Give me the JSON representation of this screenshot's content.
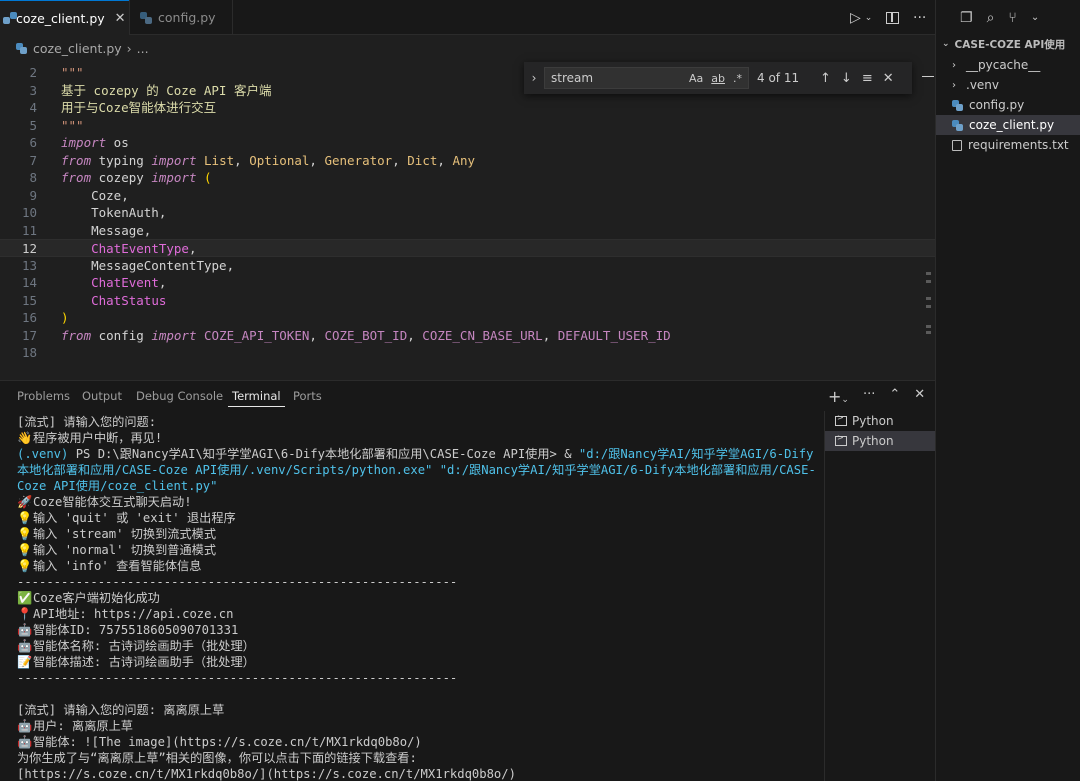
{
  "tabs": [
    {
      "label": "coze_client.py",
      "active": true
    },
    {
      "label": "config.py",
      "active": false
    }
  ],
  "breadcrumb": {
    "file": "coze_client.py",
    "sep": "›",
    "more": "..."
  },
  "find": {
    "value": "stream",
    "case_opt": "Aa",
    "word_opt": "ab",
    "regex_opt": ".*",
    "count": "4 of 11"
  },
  "code_lines": [
    {
      "n": "2",
      "html": "<span class=\"str\">\"\"\"</span>"
    },
    {
      "n": "3",
      "html": "<span class=\"cn\">基于</span><span class=\"tx\"> </span><span class=\"cn\">cozepy 的 Coze API 客户端</span>"
    },
    {
      "n": "4",
      "html": "<span class=\"cn\">用于与Coze智能体进行交互</span>"
    },
    {
      "n": "5",
      "html": "<span class=\"str\">\"\"\"</span>"
    },
    {
      "n": "6",
      "html": "<span class=\"kw\">import</span><span class=\"tx\"> os</span>"
    },
    {
      "n": "7",
      "html": "<span class=\"kw\">from</span><span class=\"tx\"> typing </span><span class=\"kw\">import</span><span class=\"tx\"> </span><span class=\"ty\">List</span><span class=\"tx\">, </span><span class=\"ty\">Optional</span><span class=\"tx\">, </span><span class=\"ty\">Generator</span><span class=\"tx\">, </span><span class=\"ty\">Dict</span><span class=\"tx\">, </span><span class=\"ty\">Any</span>"
    },
    {
      "n": "8",
      "html": "<span class=\"kw\">from</span><span class=\"tx\"> cozepy </span><span class=\"kw\">import</span><span class=\"tx\"> </span><span class=\"brk\">(</span>"
    },
    {
      "n": "9",
      "html": "<span class=\"tx\">    Coze,</span>"
    },
    {
      "n": "10",
      "html": "<span class=\"tx\">    TokenAuth,</span>"
    },
    {
      "n": "11",
      "html": "<span class=\"tx\">    Message,</span>"
    },
    {
      "n": "12",
      "html": "<span class=\"tx\">    </span><span class=\"pink\">ChatEventType</span><span class=\"tx\">,</span>"
    },
    {
      "n": "13",
      "html": "<span class=\"tx\">    MessageContentType,</span>"
    },
    {
      "n": "14",
      "html": "<span class=\"tx\">    </span><span class=\"pink\">ChatEvent</span><span class=\"tx\">,</span>"
    },
    {
      "n": "15",
      "html": "<span class=\"tx\">    </span><span class=\"pink\">ChatStatus</span>"
    },
    {
      "n": "16",
      "html": "<span class=\"brk\">)</span>"
    },
    {
      "n": "17",
      "html": "<span class=\"kw\">from</span><span class=\"tx\"> config </span><span class=\"kw\">import</span><span class=\"tx\"> </span><span class=\"const\">COZE_API_TOKEN</span><span class=\"tx\">, </span><span class=\"const\">COZE_BOT_ID</span><span class=\"tx\">, </span><span class=\"const\">COZE_CN_BASE_URL</span><span class=\"tx\">, </span><span class=\"const\">DEFAULT_USER_ID</span>"
    },
    {
      "n": "18",
      "html": ""
    }
  ],
  "current_line": "12",
  "panel": {
    "tabs": [
      "Problems",
      "Output",
      "Debug Console",
      "Terminal",
      "Ports"
    ],
    "active": "Terminal"
  },
  "terminal_lines": [
    {
      "e": "",
      "t": "[流式] 请输入您的问题:"
    },
    {
      "e": "👋",
      "t": "程序被用户中断，再见!"
    },
    {
      "e": "",
      "t": "(.venv) PS D:\\跟Nancy学AI\\知乎学堂AGI\\6-Dify本地化部署和应用\\CASE-Coze API使用> & \"d:/跟Nancy学AI/知乎学堂AGI/6-Dify",
      "cls": "mix"
    },
    {
      "e": "",
      "t": "本地化部署和应用/CASE-Coze API使用/.venv/Scripts/python.exe\" \"d:/跟Nancy学AI/知乎学堂AGI/6-Dify本地化部署和应用/CASE-",
      "cls": "cy"
    },
    {
      "e": "",
      "t": "Coze API使用/coze_client.py\"",
      "cls": "cy"
    },
    {
      "e": "🚀",
      "t": "Coze智能体交互式聊天启动!"
    },
    {
      "e": "💡",
      "t": "输入 'quit' 或 'exit' 退出程序"
    },
    {
      "e": "💡",
      "t": "输入 'stream' 切换到流式模式"
    },
    {
      "e": "💡",
      "t": "输入 'normal' 切换到普通模式"
    },
    {
      "e": "💡",
      "t": "输入 'info' 查看智能体信息"
    },
    {
      "e": "",
      "t": "------------------------------------------------------------"
    },
    {
      "e": "✅",
      "t": "Coze客户端初始化成功"
    },
    {
      "e": "📍",
      "t": "API地址: https://api.coze.cn"
    },
    {
      "e": "🤖",
      "t": "智能体ID: 7575518605090701331"
    },
    {
      "e": "🤖",
      "t": "智能体名称: 古诗词绘画助手（批处理）"
    },
    {
      "e": "📝",
      "t": "智能体描述: 古诗词绘画助手（批处理）"
    },
    {
      "e": "",
      "t": "------------------------------------------------------------"
    },
    {
      "e": "",
      "t": ""
    },
    {
      "e": "",
      "t": "[流式] 请输入您的问题: 离离原上草"
    },
    {
      "e": "🤖",
      "t": "用户: 离离原上草"
    },
    {
      "e": "🤖",
      "t": "智能体: ![The image](https://s.coze.cn/t/MX1rkdq0b8o/)"
    },
    {
      "e": "",
      "t": "为你生成了与“离离原上草”相关的图像，你可以点击下面的链接下载查看:"
    },
    {
      "e": "",
      "t": "[https://s.coze.cn/t/MX1rkdq0b8o/](https://s.coze.cn/t/MX1rkdq0b8o/)"
    }
  ],
  "terminal_list": [
    {
      "label": "Python",
      "selected": false
    },
    {
      "label": "Python",
      "selected": true
    }
  ],
  "explorer": {
    "title": "CASE-COZE API使用",
    "items": [
      {
        "label": "__pycache__",
        "type": "folder",
        "indent": 1
      },
      {
        "label": ".venv",
        "type": "folder",
        "indent": 1
      },
      {
        "label": "config.py",
        "type": "py",
        "indent": 0
      },
      {
        "label": "coze_client.py",
        "type": "py",
        "indent": 0,
        "selected": true
      },
      {
        "label": "requirements.txt",
        "type": "txt",
        "indent": 0
      }
    ]
  }
}
